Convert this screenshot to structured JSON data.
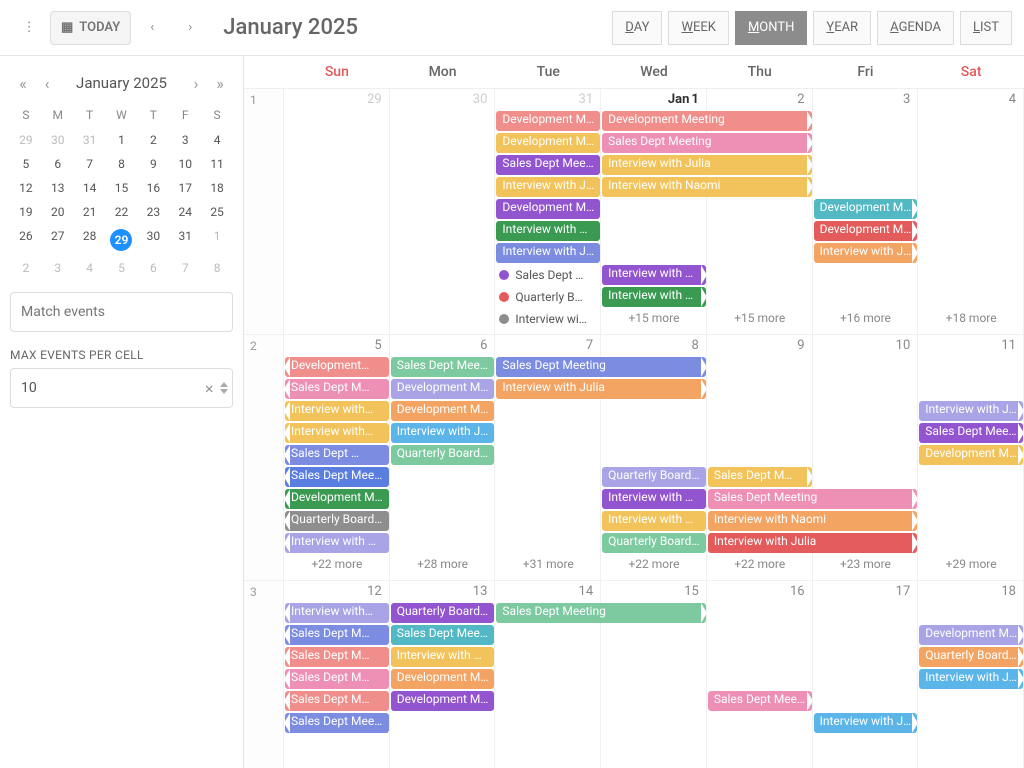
{
  "toolbar": {
    "today": "TODAY",
    "title": "January 2025",
    "views": {
      "day": "AY",
      "day_u": "D",
      "week": "EEK",
      "week_u": "W",
      "month": "ONTH",
      "month_u": "M",
      "year": "EAR",
      "year_u": "Y",
      "agenda": "GENDA",
      "agenda_u": "A",
      "list": "IST",
      "list_u": "L"
    }
  },
  "mini": {
    "title": "January 2025",
    "dow": [
      "S",
      "M",
      "T",
      "W",
      "T",
      "F",
      "S"
    ],
    "cells": [
      {
        "n": "29",
        "dim": true
      },
      {
        "n": "30",
        "dim": true
      },
      {
        "n": "31",
        "dim": true
      },
      {
        "n": "1"
      },
      {
        "n": "2"
      },
      {
        "n": "3"
      },
      {
        "n": "4"
      },
      {
        "n": "5"
      },
      {
        "n": "6"
      },
      {
        "n": "7"
      },
      {
        "n": "8"
      },
      {
        "n": "9"
      },
      {
        "n": "10"
      },
      {
        "n": "11"
      },
      {
        "n": "12"
      },
      {
        "n": "13"
      },
      {
        "n": "14"
      },
      {
        "n": "15"
      },
      {
        "n": "16"
      },
      {
        "n": "17"
      },
      {
        "n": "18"
      },
      {
        "n": "19"
      },
      {
        "n": "20"
      },
      {
        "n": "21"
      },
      {
        "n": "22"
      },
      {
        "n": "23"
      },
      {
        "n": "24"
      },
      {
        "n": "25"
      },
      {
        "n": "26"
      },
      {
        "n": "27"
      },
      {
        "n": "28"
      },
      {
        "n": "29",
        "sel": true
      },
      {
        "n": "30"
      },
      {
        "n": "31"
      },
      {
        "n": "1",
        "dim": true
      },
      {
        "n": "2",
        "dim": true
      },
      {
        "n": "3",
        "dim": true
      },
      {
        "n": "4",
        "dim": true
      },
      {
        "n": "5",
        "dim": true
      },
      {
        "n": "6",
        "dim": true
      },
      {
        "n": "7",
        "dim": true
      },
      {
        "n": "8",
        "dim": true
      }
    ]
  },
  "sidebar": {
    "match_placeholder": "Match events",
    "max_label": "MAX EVENTS PER CELL",
    "max_value": "10"
  },
  "dow": [
    "Sun",
    "Mon",
    "Tue",
    "Wed",
    "Thu",
    "Fri",
    "Sat"
  ],
  "week1": {
    "wk": "1",
    "days": [
      {
        "n": "29",
        "dim": true
      },
      {
        "n": "30",
        "dim": true
      },
      {
        "n": "31",
        "dim": true
      },
      {
        "n": "1",
        "first": true,
        "mon": "Jan"
      },
      {
        "n": "2"
      },
      {
        "n": "3"
      },
      {
        "n": "4"
      }
    ],
    "rows": [
      [
        null,
        null,
        {
          "t": "Development Meeting",
          "c": "c-salmon",
          "span": 3
        },
        null,
        null,
        {
          "t": "Development Meeting",
          "c": "c-salmon",
          "span": 2,
          "ar": true
        }
      ],
      [
        null,
        null,
        {
          "t": "Development Meeting",
          "c": "c-yellow",
          "span": 3
        },
        null,
        null,
        {
          "t": "Sales Dept Meeting",
          "c": "c-pink",
          "span": 2,
          "ar": true
        }
      ],
      [
        null,
        null,
        {
          "t": "Sales Dept Meeting",
          "c": "c-purple",
          "span": 3
        },
        null,
        null,
        {
          "t": "Interview with Julia",
          "c": "c-yellow",
          "span": 2,
          "ar": true
        }
      ],
      [
        null,
        null,
        {
          "t": "Interview with Julia",
          "c": "c-yellow",
          "span": 3
        },
        null,
        null,
        {
          "t": "Interview with Naomi",
          "c": "c-yellow",
          "span": 2,
          "ar": true
        }
      ],
      [
        null,
        null,
        {
          "t": "Development Meeting",
          "c": "c-purple",
          "span": 2
        },
        null,
        {
          "t": "Development Meeting",
          "c": "c-teal",
          "span": 3,
          "ar": true
        }
      ],
      [
        null,
        null,
        {
          "t": "Interview with Naomi",
          "c": "c-darkgreen",
          "span": 2
        },
        null,
        {
          "t": "Development Meeting",
          "c": "c-red",
          "span": 3,
          "ar": true
        }
      ],
      [
        null,
        null,
        {
          "t": "Interview with Julia",
          "c": "c-ind",
          "span": 2
        },
        null,
        {
          "t": "Interview with Julia",
          "c": "c-orange",
          "span": 3,
          "ar": true
        }
      ],
      [
        null,
        null,
        {
          "dot": "#9354d0",
          "t": "Sales Dept …"
        },
        {
          "t": "Interview with Naomi",
          "c": "c-purple",
          "span": 4,
          "ar": true
        }
      ],
      [
        null,
        null,
        {
          "dot": "#e35b5b",
          "t": "Quarterly B…"
        },
        {
          "t": "Interview with Naomi",
          "c": "c-darkgreen",
          "span": 4,
          "ar": true
        }
      ],
      [
        null,
        null,
        {
          "dot": "#8e8e8e",
          "t": "Interview wi…"
        },
        {
          "more": "+15 more"
        },
        {
          "more": "+15 more"
        },
        {
          "more": "+16 more"
        },
        {
          "more": "+18 more"
        }
      ]
    ]
  },
  "week2": {
    "wk": "2",
    "days": [
      {
        "n": "5"
      },
      {
        "n": "6"
      },
      {
        "n": "7"
      },
      {
        "n": "8"
      },
      {
        "n": "9"
      },
      {
        "n": "10"
      },
      {
        "n": "11"
      }
    ],
    "rows": [
      [
        {
          "t": "Development…",
          "c": "c-salmon",
          "al": true
        },
        {
          "t": "Sales Dept Meeting",
          "c": "c-mint",
          "span": 4
        },
        null,
        null,
        null,
        {
          "t": "Sales Dept Meeting",
          "c": "c-ind",
          "span": 2,
          "ar": true
        }
      ],
      [
        {
          "t": "Sales Dept M…",
          "c": "c-pink",
          "al": true
        },
        {
          "t": "Development Meeting",
          "c": "c-lav",
          "span": 4
        },
        null,
        null,
        null,
        {
          "t": "Interview with Julia",
          "c": "c-orange",
          "span": 2,
          "ar": true
        }
      ],
      [
        {
          "t": "Interview with…",
          "c": "c-yellow",
          "al": true
        },
        {
          "t": "Development Meeting",
          "c": "c-orange",
          "span": 3
        },
        null,
        null,
        {
          "t": "Interview with Julia",
          "c": "c-lav",
          "span": 3,
          "ar": true
        }
      ],
      [
        {
          "t": "Interview with…",
          "c": "c-yellow",
          "al": true
        },
        {
          "t": "Interview with Julia",
          "c": "c-sky",
          "span": 3
        },
        null,
        null,
        {
          "t": "Sales Dept Meeting",
          "c": "c-purple",
          "span": 3,
          "ar": true
        }
      ],
      [
        {
          "t": "Sales Dept …",
          "c": "c-ind",
          "al": true
        },
        {
          "t": "Quarterly Board Meeting",
          "c": "c-mint",
          "span": 3
        },
        null,
        null,
        {
          "t": "Development Meeting",
          "c": "c-yellow",
          "span": 3,
          "ar": true
        }
      ],
      [
        {
          "t": "Sales Dept Meeting",
          "c": "c-blue",
          "span": 2,
          "al": true
        },
        null,
        {
          "t": "Quarterly Board Meeting",
          "c": "c-lav",
          "span": 4
        },
        null,
        null,
        null,
        {
          "t": "Sales Dept M…",
          "c": "c-yellow",
          "ar": true
        }
      ],
      [
        {
          "t": "Development Meeting",
          "c": "c-darkgreen",
          "span": 2,
          "al": true
        },
        null,
        {
          "t": "Interview with Naomi",
          "c": "c-purple",
          "span": 3
        },
        null,
        null,
        {
          "t": "Sales Dept Meeting",
          "c": "c-pink",
          "span": 2,
          "ar": true
        }
      ],
      [
        {
          "t": "Quarterly Board Meeting",
          "c": "c-gray",
          "span": 2,
          "al": true
        },
        null,
        {
          "t": "Interview with Naomi",
          "c": "c-yellow",
          "span": 3
        },
        null,
        null,
        {
          "t": "Interview with Naomi",
          "c": "c-orange",
          "span": 2,
          "ar": true
        }
      ],
      [
        {
          "t": "Interview with Naomi",
          "c": "c-lav",
          "span": 2,
          "al": true
        },
        null,
        {
          "t": "Quarterly Board Meeting",
          "c": "c-mint",
          "span": 3
        },
        null,
        null,
        {
          "t": "Interview with Julia",
          "c": "c-red",
          "span": 2,
          "ar": true
        }
      ],
      [
        {
          "more": "+22 more"
        },
        {
          "more": "+28 more"
        },
        {
          "more": "+31 more"
        },
        {
          "more": "+22 more"
        },
        {
          "more": "+22 more"
        },
        {
          "more": "+23 more"
        },
        {
          "more": "+29 more"
        }
      ]
    ]
  },
  "week3": {
    "wk": "3",
    "days": [
      {
        "n": "12"
      },
      {
        "n": "13"
      },
      {
        "n": "14"
      },
      {
        "n": "15"
      },
      {
        "n": "16"
      },
      {
        "n": "17"
      },
      {
        "n": "18"
      }
    ],
    "rows": [
      [
        {
          "t": "Interview with…",
          "c": "c-lav",
          "al": true
        },
        {
          "t": "Quarterly Board Meeting",
          "c": "c-purple",
          "span": 4
        },
        null,
        null,
        null,
        {
          "t": "Sales Dept Meeting",
          "c": "c-mint",
          "span": 2,
          "ar": true
        }
      ],
      [
        {
          "t": "Sales Dept M…",
          "c": "c-ind",
          "al": true
        },
        {
          "t": "Sales Dept Meeting",
          "c": "c-teal",
          "span": 3
        },
        null,
        null,
        {
          "t": "Development Meeting",
          "c": "c-lav",
          "span": 3,
          "ar": true
        }
      ],
      [
        {
          "t": "Sales Dept M…",
          "c": "c-salmon",
          "al": true
        },
        {
          "t": "Interview with Naomi",
          "c": "c-yellow",
          "span": 3
        },
        null,
        null,
        {
          "t": "Quarterly Board Meeting",
          "c": "c-orange",
          "span": 3,
          "ar": true
        }
      ],
      [
        {
          "t": "Sales Dept M…",
          "c": "c-pink",
          "al": true
        },
        {
          "t": "Development Meeting",
          "c": "c-orange",
          "span": 3
        },
        null,
        null,
        {
          "t": "Interview with Julia",
          "c": "c-sky",
          "span": 3,
          "ar": true
        }
      ],
      [
        {
          "t": "Sales Dept M…",
          "c": "c-salmon",
          "al": true
        },
        {
          "t": "Development Meeting",
          "c": "c-purple",
          "span": 2
        },
        null,
        {
          "t": "Sales Dept Meeting",
          "c": "c-pink",
          "span": 4,
          "ar": true
        }
      ],
      [
        {
          "t": "Sales Dept Meeting",
          "c": "c-ind",
          "span": 3,
          "al": true
        },
        null,
        null,
        {
          "t": "Interview with Julia",
          "c": "c-sky",
          "span": 4,
          "ar": true
        }
      ]
    ]
  }
}
